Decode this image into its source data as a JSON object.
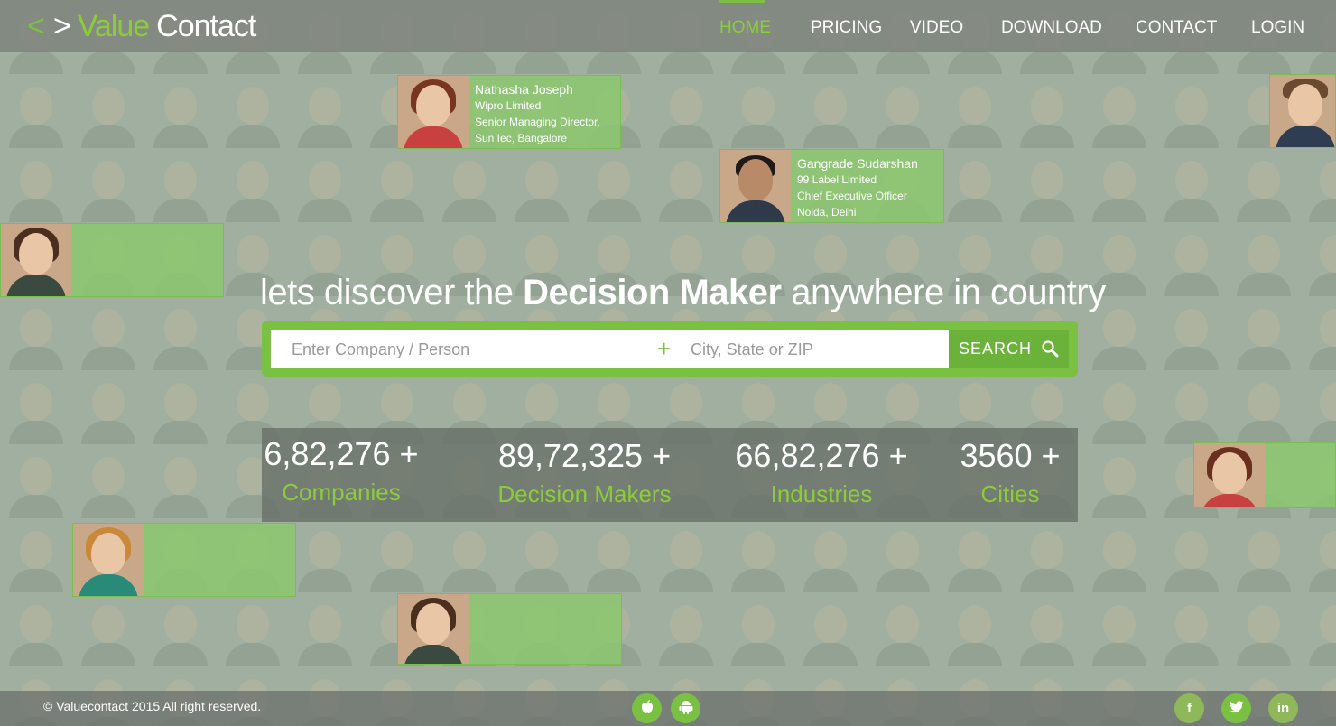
{
  "header": {
    "logo": {
      "lt": "<",
      "gt": ">",
      "word1": "Value",
      "word2": "Contact"
    },
    "nav": [
      {
        "label": "HOME",
        "active": true
      },
      {
        "label": "PRICING",
        "active": false
      },
      {
        "label": "VIDEO",
        "active": false
      },
      {
        "label": "DOWNLOAD",
        "active": false
      },
      {
        "label": "CONTACT",
        "active": false
      },
      {
        "label": "LOGIN",
        "active": false
      }
    ]
  },
  "cards": [
    {
      "name": "Nathasha Joseph",
      "company": "Wipro Limited",
      "title": "Senior Managing Director,",
      "location": "Sun Iec, Bangalore"
    },
    {
      "name": "Gangrade Sudarshan",
      "company": "99 Label Limited",
      "title": "Chief Executive Officer",
      "location": "Noida, Delhi"
    }
  ],
  "hero": {
    "title_pre": "lets discover the ",
    "title_bold": "Decision Maker",
    "title_post": " anywhere in country"
  },
  "search": {
    "company_placeholder": "Enter Company / Person",
    "plus": "+",
    "location_placeholder": "City, State or ZIP",
    "button_label": "SEARCH"
  },
  "stats": [
    {
      "number": "6,82,276 +",
      "label": "Companies"
    },
    {
      "number": "89,72,325 +",
      "label": "Decision Makers"
    },
    {
      "number": "66,82,276 +",
      "label": "Industries"
    },
    {
      "number": "3560 +",
      "label": "Cities"
    }
  ],
  "footer": {
    "copyright": "© Valuecontact 2015   All right reserved.",
    "social": {
      "facebook": "f",
      "linkedin": "in"
    }
  },
  "colors": {
    "accent": "#7ac143",
    "white": "#ffffff"
  }
}
